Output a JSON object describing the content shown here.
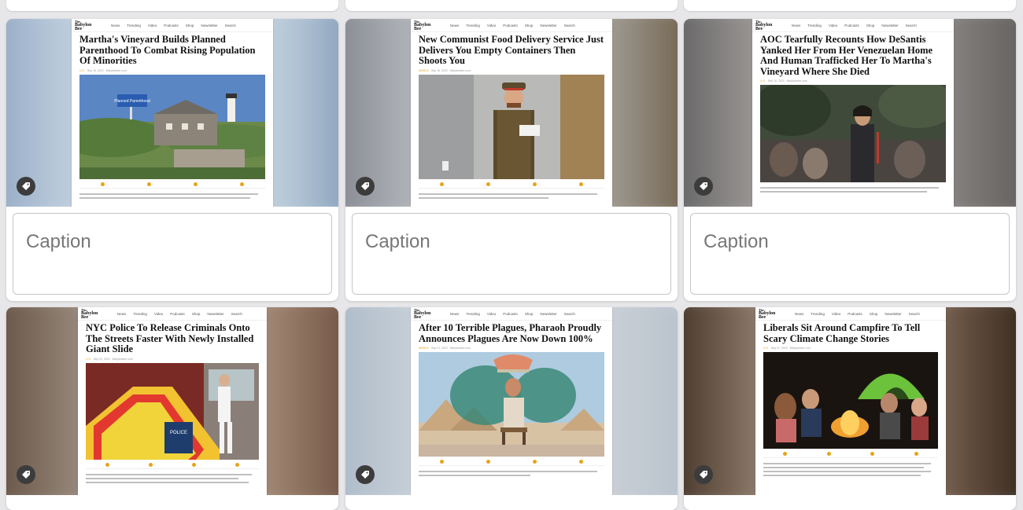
{
  "gallery": {
    "cards": [
      {
        "headline": "Martha's Vineyard Builds Planned Parenthood To Combat Rising Population Of Minorities",
        "category": "U.S.",
        "date": "Sep 16, 2022 · Babylonbee.com",
        "sign_text": "Planned Parenthood",
        "caption_placeholder": "Caption"
      },
      {
        "headline": "New Communist Food Delivery Service Just Delivers You Empty Containers Then Shoots You",
        "category": "WORLD",
        "date": "Sep 16, 2022 · Babylonbee.com",
        "caption_placeholder": "Caption"
      },
      {
        "headline": "AOC Tearfully Recounts How DeSantis Yanked Her From Her Venezuelan Home And Human Trafficked Her To Martha's Vineyard Where She Died",
        "category": "U.S.",
        "date": "Sep 16, 2022 · Babylonbee.com",
        "caption_placeholder": "Caption"
      },
      {
        "headline": "NYC Police To Release Criminals Onto The Streets Faster With Newly Installed Giant Slide",
        "category": "U.S.",
        "date": "Sep 20, 2022 · Babylonbee.com",
        "sign_text": "POLICE"
      },
      {
        "headline": "After 10 Terrible Plagues, Pharaoh Proudly Announces Plagues Are Now Down 100%",
        "category": "WORLD",
        "date": "Sep 21, 2022 · Babylonbee.com"
      },
      {
        "headline": "Liberals Sit Around Campfire To Tell Scary Climate Change Stories",
        "category": "U.S.",
        "date": "Sep 21, 2022 · Babylonbee.com"
      }
    ]
  },
  "site": {
    "logo_the": "The",
    "logo_name": "Babylon Bee",
    "nav": [
      "News",
      "Trending",
      "Video",
      "Podcasts",
      "Shop",
      "Newsletter",
      "Search"
    ]
  },
  "colors": {
    "share_icons": [
      "#e7a31a",
      "#e7a31a",
      "#e7a31a",
      "#e7a31a",
      "#e7a31a"
    ]
  },
  "icons": {
    "tag": "tag-icon"
  }
}
